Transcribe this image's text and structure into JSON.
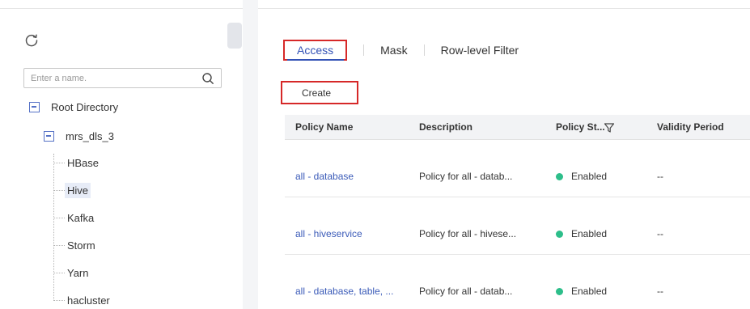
{
  "tree_panel": {
    "search_placeholder": "Enter a name.",
    "root": {
      "label": "Root Directory"
    },
    "service": {
      "label": "mrs_dls_3"
    },
    "leaves": [
      {
        "label": "HBase",
        "selected": false
      },
      {
        "label": "Hive",
        "selected": true
      },
      {
        "label": "Kafka",
        "selected": false
      },
      {
        "label": "Storm",
        "selected": false
      },
      {
        "label": "Yarn",
        "selected": false
      },
      {
        "label": "hacluster",
        "selected": false
      }
    ]
  },
  "tabs": [
    {
      "label": "Access",
      "active": true
    },
    {
      "label": "Mask",
      "active": false
    },
    {
      "label": "Row-level Filter",
      "active": false
    }
  ],
  "toolbar": {
    "create_label": "Create"
  },
  "table": {
    "columns": [
      "Policy Name",
      "Description",
      "Policy St...",
      "Validity Period"
    ],
    "rows": [
      {
        "name": "all - database",
        "description": "Policy for all - datab...",
        "status": "Enabled",
        "validity": "--"
      },
      {
        "name": "all - hiveservice",
        "description": "Policy for all - hivese...",
        "status": "Enabled",
        "validity": "--"
      },
      {
        "name": "all - database, table, ...",
        "description": "Policy for all - datab...",
        "status": "Enabled",
        "validity": "--"
      }
    ]
  },
  "colors": {
    "accent": "#3352b6",
    "status_enabled": "#2dbe8a",
    "highlight_box": "#d62828",
    "tree_icon": "#5571c6"
  },
  "icons": {
    "refresh": "refresh-icon",
    "search": "search-icon",
    "collapse": "collapse-icon",
    "filter": "filter-icon"
  }
}
